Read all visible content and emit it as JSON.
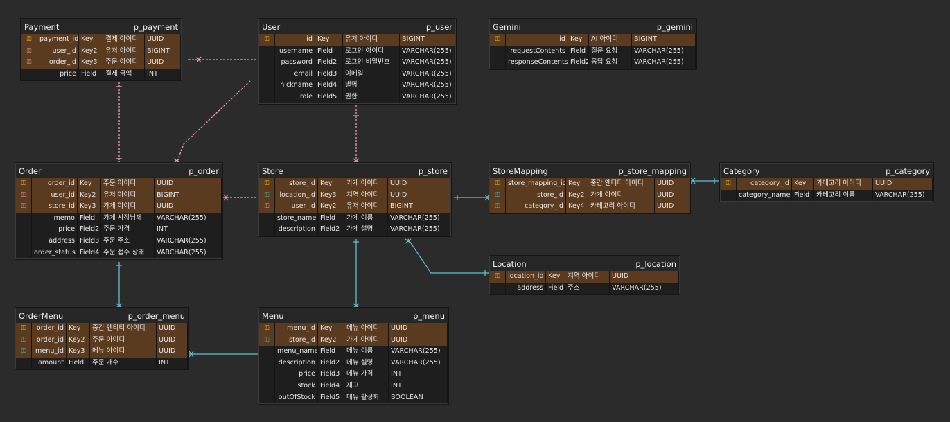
{
  "colors": {
    "background": "#2b2b2b",
    "key_row": "#5a3b20",
    "primary_key_icon": "#f2c21b",
    "foreign_key_icon_pink": "#e89aa9",
    "foreign_key_icon_teal": "#40c4be",
    "relation_pink": "#e9a2b0",
    "relation_teal": "#5ec1d2"
  },
  "tables": {
    "payment": {
      "title": "Payment",
      "alias": "p_payment",
      "rows": [
        {
          "icon": "pk-icon",
          "name": "payment_id",
          "kind": "Key",
          "desc": "결제 아이디",
          "type": "UUID"
        },
        {
          "icon": "fk-pink-icon",
          "name": "user_id",
          "kind": "Key2",
          "desc": "유저 아이디",
          "type": "BIGINT"
        },
        {
          "icon": "fk-pink-icon",
          "name": "order_id",
          "kind": "Key3",
          "desc": "주문 아이디",
          "type": "UUID"
        },
        {
          "icon": "",
          "name": "price",
          "kind": "Field",
          "desc": "결제 금액",
          "type": "INT"
        }
      ]
    },
    "user": {
      "title": "User",
      "alias": "p_user",
      "rows": [
        {
          "icon": "pk-icon",
          "name": "id",
          "kind": "Key",
          "desc": "유저 아이디",
          "type": "BIGINT"
        },
        {
          "icon": "",
          "name": "username",
          "kind": "Field",
          "desc": "로그인 아이디",
          "type": "VARCHAR(255)"
        },
        {
          "icon": "",
          "name": "password",
          "kind": "Field2",
          "desc": "로그인 비밀번호",
          "type": "VARCHAR(255)"
        },
        {
          "icon": "",
          "name": "email",
          "kind": "Field3",
          "desc": "이메일",
          "type": "VARCHAR(255)"
        },
        {
          "icon": "",
          "name": "nickname",
          "kind": "Field4",
          "desc": "별명",
          "type": "VARCHAR(255)"
        },
        {
          "icon": "",
          "name": "role",
          "kind": "Field5",
          "desc": "권한",
          "type": "VARCHAR(255)"
        }
      ]
    },
    "gemini": {
      "title": "Gemini",
      "alias": "p_gemini",
      "rows": [
        {
          "icon": "pk-icon",
          "name": "id",
          "kind": "Key",
          "desc": "AI 아이디",
          "type": "BIGINT"
        },
        {
          "icon": "",
          "name": "requestContents",
          "kind": "Field",
          "desc": "질문 요청",
          "type": "VARCHAR(255)"
        },
        {
          "icon": "",
          "name": "responseContents",
          "kind": "Field2",
          "desc": "응답 요청",
          "type": "VARCHAR(255)"
        }
      ]
    },
    "order": {
      "title": "Order",
      "alias": "p_order",
      "rows": [
        {
          "icon": "pk-icon",
          "name": "order_id",
          "kind": "Key",
          "desc": "주문 아이디",
          "type": "UUID"
        },
        {
          "icon": "fk-pink-icon",
          "name": "user_id",
          "kind": "Key2",
          "desc": "유저 아이디",
          "type": "BIGINT"
        },
        {
          "icon": "fk-pink-icon",
          "name": "store_id",
          "kind": "Key3",
          "desc": "가게 아이디",
          "type": "UUID"
        },
        {
          "icon": "",
          "name": "memo",
          "kind": "Field",
          "desc": "가게 사장님께",
          "type": "VARCHAR(255)"
        },
        {
          "icon": "",
          "name": "price",
          "kind": "Field2",
          "desc": "주문 가격",
          "type": "INT"
        },
        {
          "icon": "",
          "name": "address",
          "kind": "Field3",
          "desc": "주문 주소",
          "type": "VARCHAR(255)"
        },
        {
          "icon": "",
          "name": "order_status",
          "kind": "Field4",
          "desc": "주문 접수 상태",
          "type": "VARCHAR(255)"
        }
      ]
    },
    "store": {
      "title": "Store",
      "alias": "p_store",
      "rows": [
        {
          "icon": "pk-icon",
          "name": "store_id",
          "kind": "Key",
          "desc": "가게 아이디",
          "type": "UUID"
        },
        {
          "icon": "fk-teal-icon",
          "name": "location_id",
          "kind": "Key3",
          "desc": "지역 아이디",
          "type": "UUID"
        },
        {
          "icon": "fk-pink-icon",
          "name": "user_id",
          "kind": "Key2",
          "desc": "유저 아이디",
          "type": "BIGINT"
        },
        {
          "icon": "",
          "name": "store_name",
          "kind": "Field",
          "desc": "가게 이름",
          "type": "VARCHAR(255)"
        },
        {
          "icon": "",
          "name": "description",
          "kind": "Field2",
          "desc": "가게 설명",
          "type": "VARCHAR(255)"
        }
      ]
    },
    "storemapping": {
      "title": "StoreMapping",
      "alias": "p_store_mapping",
      "rows": [
        {
          "icon": "pk-icon",
          "name": "store_mapping_id",
          "kind": "Key",
          "desc": "중간 엔티티 아이디",
          "type": "UUID"
        },
        {
          "icon": "fk-teal-icon",
          "name": "store_id",
          "kind": "Key2",
          "desc": "가게 아이디",
          "type": "UUID"
        },
        {
          "icon": "fk-teal-icon",
          "name": "category_id",
          "kind": "Key4",
          "desc": "카테고리 아이디",
          "type": "UUID"
        }
      ]
    },
    "category": {
      "title": "Category",
      "alias": "p_category",
      "rows": [
        {
          "icon": "pk-icon",
          "name": "category_id",
          "kind": "Key",
          "desc": "카테고리 아이디",
          "type": "UUID"
        },
        {
          "icon": "",
          "name": "category_name",
          "kind": "Field",
          "desc": "카테고리 이름",
          "type": "VARCHAR(255)"
        }
      ]
    },
    "location": {
      "title": "Location",
      "alias": "p_location",
      "rows": [
        {
          "icon": "pk-icon",
          "name": "location_id",
          "kind": "Key",
          "desc": "지역 아이디",
          "type": "UUID"
        },
        {
          "icon": "",
          "name": "address",
          "kind": "Field",
          "desc": "주소",
          "type": "VARCHAR(255)"
        }
      ]
    },
    "ordermenu": {
      "title": "OrderMenu",
      "alias": "p_order_menu",
      "rows": [
        {
          "icon": "pk-icon",
          "name": "order_id",
          "kind": "Key",
          "desc": "중간 엔티티 아이디",
          "type": "UUID"
        },
        {
          "icon": "fk-teal-icon",
          "name": "order_id",
          "kind": "Key2",
          "desc": "주문 아이디",
          "type": "UUID"
        },
        {
          "icon": "fk-teal-icon",
          "name": "menu_id",
          "kind": "Key3",
          "desc": "메뉴 아이디",
          "type": "UUID"
        },
        {
          "icon": "",
          "name": "amount",
          "kind": "Field",
          "desc": "주문 개수",
          "type": "INT"
        }
      ]
    },
    "menu": {
      "title": "Menu",
      "alias": "p_menu",
      "rows": [
        {
          "icon": "pk-icon",
          "name": "menu_id",
          "kind": "Key",
          "desc": "메뉴 아이디",
          "type": "UUID"
        },
        {
          "icon": "fk-teal-icon",
          "name": "store_id",
          "kind": "Key2",
          "desc": "가게 아이디",
          "type": "UUID"
        },
        {
          "icon": "",
          "name": "menu_name",
          "kind": "Field",
          "desc": "메뉴 이름",
          "type": "VARCHAR(255)"
        },
        {
          "icon": "",
          "name": "description",
          "kind": "Field2",
          "desc": "메뉴 설명",
          "type": "VARCHAR(255)"
        },
        {
          "icon": "",
          "name": "price",
          "kind": "Field3",
          "desc": "메뉴 가격",
          "type": "INT"
        },
        {
          "icon": "",
          "name": "stock",
          "kind": "Field4",
          "desc": "재고",
          "type": "INT"
        },
        {
          "icon": "",
          "name": "outOfStock",
          "kind": "Field5",
          "desc": "메뉴 활성화",
          "type": "BOOLEAN"
        }
      ]
    }
  }
}
